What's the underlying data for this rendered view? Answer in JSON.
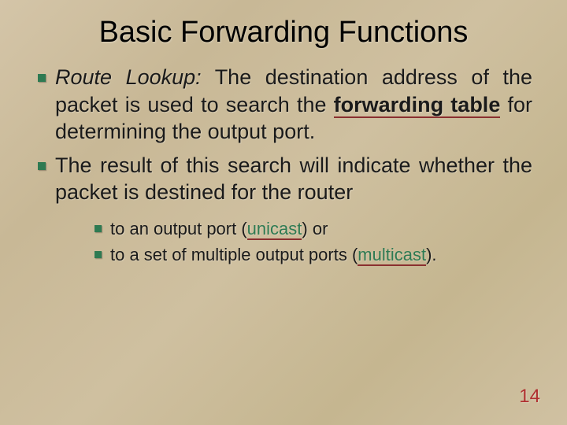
{
  "title": "Basic Forwarding Functions",
  "bullets": {
    "b1": {
      "term": "Route Lookup:",
      "t1": " The destination address of the packet is used to search the ",
      "fwd": "forwarding table",
      "t2": " for determining the output port."
    },
    "b2": {
      "text": "The result of this search will indicate whether the packet is destined for the router"
    }
  },
  "sub": {
    "s1": {
      "pre": "to an output port (",
      "hl": "unicast",
      "post": ") or"
    },
    "s2": {
      "pre": "to a set of multiple output ports (",
      "hl": "multicast",
      "post": ")."
    }
  },
  "page": "14"
}
